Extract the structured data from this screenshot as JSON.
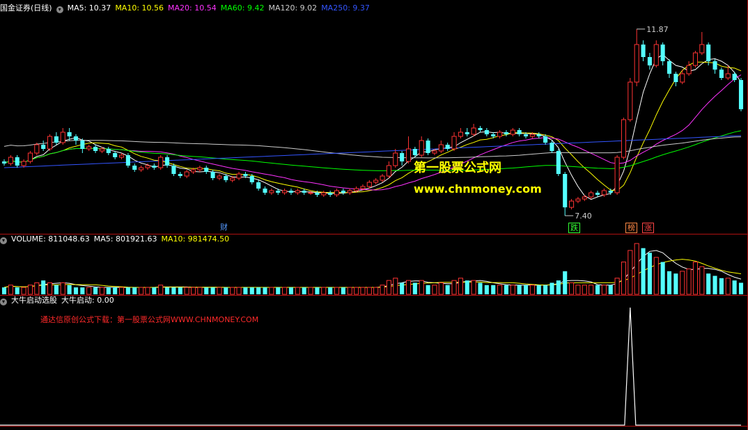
{
  "main_panel": {
    "title": "国金证券(日线)",
    "indicators": [
      {
        "label": "MA5: 10.37",
        "color": "#ffffff"
      },
      {
        "label": "MA10: 10.56",
        "color": "#ffff00"
      },
      {
        "label": "MA20: 10.54",
        "color": "#ff33ff"
      },
      {
        "label": "MA60: 9.42",
        "color": "#00ff00"
      },
      {
        "label": "MA120: 9.02",
        "color": "#cccccc"
      },
      {
        "label": "MA250: 9.37",
        "color": "#3355ff"
      }
    ],
    "high_label": "11.87",
    "low_label": "7.40",
    "markers": [
      {
        "text": "财",
        "color": "#5599ff"
      },
      {
        "text": "跌",
        "color": "#33ff33"
      },
      {
        "text": "榜",
        "color": "#ff8844"
      },
      {
        "text": "涨",
        "color": "#ff4444"
      }
    ],
    "watermark_title": "第一股票公式网",
    "watermark_url": "www.chnmoney.com"
  },
  "volume_panel": {
    "indicators": [
      {
        "label": "VOLUME: 811048.63",
        "color": "#ffffff"
      },
      {
        "label": "MA5: 801921.63",
        "color": "#ffffff"
      },
      {
        "label": "MA10: 981474.50",
        "color": "#ffff00"
      }
    ]
  },
  "signal_panel": {
    "indicators": [
      {
        "label": "大牛启动选股",
        "color": "#ffffff"
      },
      {
        "label": "大牛启动: 0.00",
        "color": "#ffffff"
      }
    ],
    "note": "通达信原创公式下载：第一股票公式网WWW.CHNMONEY.COM"
  },
  "colors": {
    "up": "#ff3333",
    "down": "#54ffff",
    "grid": "#b01010",
    "bg": "#000000"
  },
  "chart_data": {
    "type": "candlestick",
    "ohlc": [
      [
        8.7,
        8.65,
        8.75,
        8.6
      ],
      [
        8.65,
        8.8,
        8.85,
        8.6
      ],
      [
        8.8,
        8.6,
        8.85,
        8.55
      ],
      [
        8.6,
        8.7,
        8.75,
        8.55
      ],
      [
        8.7,
        8.9,
        8.95,
        8.65
      ],
      [
        8.9,
        9.1,
        9.15,
        8.85
      ],
      [
        9.1,
        9.0,
        9.2,
        8.95
      ],
      [
        9.0,
        9.3,
        9.35,
        8.95
      ],
      [
        9.3,
        9.15,
        9.4,
        9.1
      ],
      [
        9.15,
        9.4,
        9.5,
        9.1
      ],
      [
        9.4,
        9.3,
        9.5,
        9.2
      ],
      [
        9.3,
        9.2,
        9.35,
        9.1
      ],
      [
        9.2,
        9.0,
        9.25,
        8.9
      ],
      [
        9.0,
        9.05,
        9.1,
        8.95
      ],
      [
        9.05,
        8.95,
        9.1,
        8.9
      ],
      [
        8.95,
        9.0,
        9.05,
        8.9
      ],
      [
        9.0,
        8.9,
        9.05,
        8.85
      ],
      [
        8.9,
        8.8,
        8.95,
        8.75
      ],
      [
        8.8,
        8.85,
        8.9,
        8.75
      ],
      [
        8.85,
        8.6,
        8.9,
        8.55
      ],
      [
        8.6,
        8.5,
        8.65,
        8.45
      ],
      [
        8.5,
        8.55,
        8.6,
        8.45
      ],
      [
        8.55,
        8.6,
        8.65,
        8.5
      ],
      [
        8.6,
        8.55,
        8.65,
        8.5
      ],
      [
        8.55,
        8.8,
        8.85,
        8.5
      ],
      [
        8.8,
        8.6,
        8.85,
        8.55
      ],
      [
        8.6,
        8.4,
        8.65,
        8.35
      ],
      [
        8.4,
        8.35,
        8.45,
        8.3
      ],
      [
        8.35,
        8.45,
        8.5,
        8.3
      ],
      [
        8.45,
        8.5,
        8.55,
        8.4
      ],
      [
        8.5,
        8.55,
        8.6,
        8.45
      ],
      [
        8.55,
        8.45,
        8.6,
        8.4
      ],
      [
        8.45,
        8.3,
        8.5,
        8.25
      ],
      [
        8.3,
        8.35,
        8.4,
        8.25
      ],
      [
        8.35,
        8.25,
        8.4,
        8.2
      ],
      [
        8.25,
        8.3,
        8.35,
        8.2
      ],
      [
        8.3,
        8.4,
        8.45,
        8.25
      ],
      [
        8.4,
        8.35,
        8.45,
        8.3
      ],
      [
        8.35,
        8.2,
        8.4,
        8.15
      ],
      [
        8.2,
        8.05,
        8.25,
        8.0
      ],
      [
        8.05,
        7.95,
        8.1,
        7.9
      ],
      [
        7.95,
        8.0,
        8.05,
        7.9
      ],
      [
        8.0,
        7.95,
        8.05,
        7.9
      ],
      [
        7.95,
        8.0,
        8.05,
        7.9
      ],
      [
        8.0,
        7.95,
        8.05,
        7.9
      ],
      [
        7.95,
        8.0,
        8.05,
        7.9
      ],
      [
        8.0,
        7.95,
        8.05,
        7.9
      ],
      [
        7.95,
        7.95,
        8.0,
        7.9
      ],
      [
        7.95,
        7.9,
        8.0,
        7.85
      ],
      [
        7.9,
        7.95,
        8.0,
        7.85
      ],
      [
        7.95,
        7.9,
        8.0,
        7.85
      ],
      [
        7.9,
        8.0,
        8.05,
        7.85
      ],
      [
        8.0,
        7.95,
        8.05,
        7.9
      ],
      [
        7.95,
        8.0,
        8.05,
        7.9
      ],
      [
        8.0,
        8.05,
        8.1,
        7.95
      ],
      [
        8.05,
        8.1,
        8.15,
        8.0
      ],
      [
        8.1,
        8.2,
        8.25,
        8.05
      ],
      [
        8.2,
        8.25,
        8.3,
        8.15
      ],
      [
        8.25,
        8.35,
        8.4,
        8.2
      ],
      [
        8.35,
        8.6,
        8.7,
        8.3
      ],
      [
        8.6,
        8.9,
        9.0,
        8.55
      ],
      [
        8.9,
        8.7,
        8.95,
        8.6
      ],
      [
        8.7,
        9.0,
        9.3,
        8.65
      ],
      [
        9.0,
        8.85,
        9.05,
        8.8
      ],
      [
        8.85,
        9.2,
        9.3,
        8.8
      ],
      [
        9.2,
        8.9,
        9.25,
        8.85
      ],
      [
        8.9,
        8.95,
        9.0,
        8.85
      ],
      [
        8.95,
        9.1,
        9.2,
        8.9
      ],
      [
        9.1,
        9.0,
        9.15,
        8.95
      ],
      [
        9.0,
        9.3,
        9.4,
        8.95
      ],
      [
        9.3,
        9.4,
        9.5,
        9.25
      ],
      [
        9.4,
        9.35,
        9.5,
        9.3
      ],
      [
        9.35,
        9.5,
        9.6,
        9.3
      ],
      [
        9.5,
        9.45,
        9.55,
        9.4
      ],
      [
        9.45,
        9.35,
        9.5,
        9.3
      ],
      [
        9.35,
        9.3,
        9.4,
        9.25
      ],
      [
        9.3,
        9.4,
        9.45,
        9.25
      ],
      [
        9.4,
        9.35,
        9.45,
        9.3
      ],
      [
        9.35,
        9.45,
        9.5,
        9.3
      ],
      [
        9.45,
        9.35,
        9.5,
        9.3
      ],
      [
        9.35,
        9.3,
        9.4,
        9.25
      ],
      [
        9.3,
        9.35,
        9.4,
        9.25
      ],
      [
        9.35,
        9.3,
        9.4,
        9.25
      ],
      [
        9.3,
        9.15,
        9.35,
        9.1
      ],
      [
        9.15,
        8.95,
        9.2,
        8.9
      ],
      [
        8.95,
        8.4,
        9.0,
        8.35
      ],
      [
        8.4,
        7.6,
        8.45,
        7.4
      ],
      [
        7.6,
        7.75,
        7.8,
        7.55
      ],
      [
        7.75,
        7.8,
        7.85,
        7.7
      ],
      [
        7.8,
        7.85,
        7.9,
        7.75
      ],
      [
        7.85,
        7.95,
        8.0,
        7.8
      ],
      [
        7.95,
        7.9,
        8.0,
        7.85
      ],
      [
        7.9,
        8.0,
        8.05,
        7.85
      ],
      [
        8.0,
        7.95,
        8.05,
        7.9
      ],
      [
        7.95,
        8.8,
        8.85,
        7.9
      ],
      [
        8.8,
        9.7,
        9.75,
        8.75
      ],
      [
        9.7,
        10.6,
        10.7,
        9.65
      ],
      [
        10.6,
        11.5,
        11.87,
        10.5
      ],
      [
        11.5,
        11.2,
        11.6,
        11.1
      ],
      [
        11.2,
        11.0,
        11.3,
        10.9
      ],
      [
        11.0,
        11.5,
        11.6,
        10.95
      ],
      [
        11.5,
        11.1,
        11.55,
        11.0
      ],
      [
        11.1,
        10.8,
        11.15,
        10.7
      ],
      [
        10.8,
        10.6,
        10.85,
        10.5
      ],
      [
        10.6,
        10.8,
        10.9,
        10.55
      ],
      [
        10.8,
        11.0,
        11.1,
        10.75
      ],
      [
        11.0,
        11.3,
        11.35,
        10.95
      ],
      [
        11.3,
        11.5,
        11.8,
        11.25
      ],
      [
        11.5,
        11.1,
        11.55,
        11.0
      ],
      [
        11.1,
        10.9,
        11.15,
        10.8
      ],
      [
        10.9,
        10.7,
        10.95,
        10.65
      ],
      [
        10.7,
        10.8,
        11.0,
        10.65
      ],
      [
        10.8,
        10.65,
        10.85,
        10.6
      ],
      [
        10.65,
        9.95,
        10.7,
        9.9
      ]
    ],
    "volume": [
      3,
      4,
      3,
      3,
      4,
      5,
      6,
      5,
      4,
      5,
      4,
      3,
      3,
      3,
      3,
      3,
      3,
      3,
      3,
      3,
      3,
      3,
      3,
      3,
      4,
      3,
      3,
      3,
      3,
      3,
      3,
      3,
      3,
      3,
      3,
      3,
      3,
      3,
      3,
      3,
      3,
      3,
      3,
      3,
      3,
      3,
      3,
      3,
      3,
      3,
      3,
      3,
      3,
      3,
      3,
      3,
      3,
      3,
      4,
      6,
      7,
      5,
      6,
      5,
      6,
      4,
      4,
      5,
      4,
      6,
      7,
      6,
      6,
      5,
      4,
      4,
      4,
      4,
      4,
      4,
      4,
      4,
      4,
      4,
      5,
      6,
      10,
      5,
      4,
      4,
      4,
      4,
      4,
      4,
      7,
      14,
      19,
      22,
      20,
      18,
      16,
      14,
      10,
      9,
      10,
      11,
      14,
      12,
      9,
      8,
      7,
      7,
      6,
      5
    ],
    "volume_scale": "x100k",
    "signal_index": 96
  }
}
